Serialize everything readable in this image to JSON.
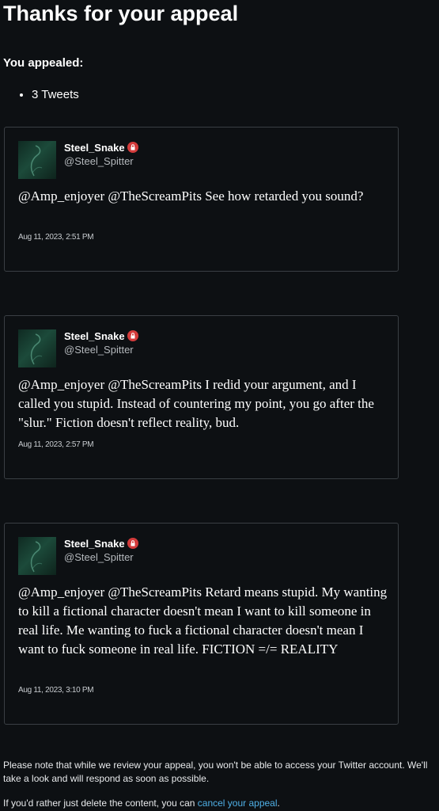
{
  "page": {
    "title": "Thanks for your appeal",
    "appealed_label": "You appealed:",
    "appealed_items": [
      "3 Tweets"
    ]
  },
  "tweets": [
    {
      "user_name": "Steel_Snake",
      "handle": "@Steel_Spitter",
      "text": "@Amp_enjoyer @TheScreamPits See how retarded you sound?",
      "date": "Aug 11, 2023, 2:51 PM"
    },
    {
      "user_name": "Steel_Snake",
      "handle": "@Steel_Spitter",
      "text": "@Amp_enjoyer @TheScreamPits I redid your argument, and I called you stupid. Instead of countering my point, you go after the \"slur.\" Fiction doesn't reflect reality, bud.",
      "date": "Aug 11, 2023, 2:57 PM"
    },
    {
      "user_name": "Steel_Snake",
      "handle": "@Steel_Spitter",
      "text": "@Amp_enjoyer @TheScreamPits Retard means stupid. My wanting to kill a fictional character doesn't mean I want to kill someone in real life. Me wanting to fuck a fictional character doesn't mean I want to fuck someone in real life. FICTION =/= REALITY",
      "date": "Aug 11, 2023, 3:10 PM"
    }
  ],
  "footer": {
    "note": "Please note that while we review your appeal, you won't be able to access your Twitter account. We'll take a look and will respond as soon as possible.",
    "cancel_prefix": "If you'd rather just delete the content, you can ",
    "cancel_link": "cancel your appeal",
    "cancel_suffix": "."
  },
  "icons": {
    "protected": "protected-lock-icon",
    "avatar": "avatar-image"
  },
  "colors": {
    "background": "#0d1013",
    "link": "#4fb0e6",
    "protected_badge": "#d33b3b",
    "card_border": "#3a3f44"
  }
}
